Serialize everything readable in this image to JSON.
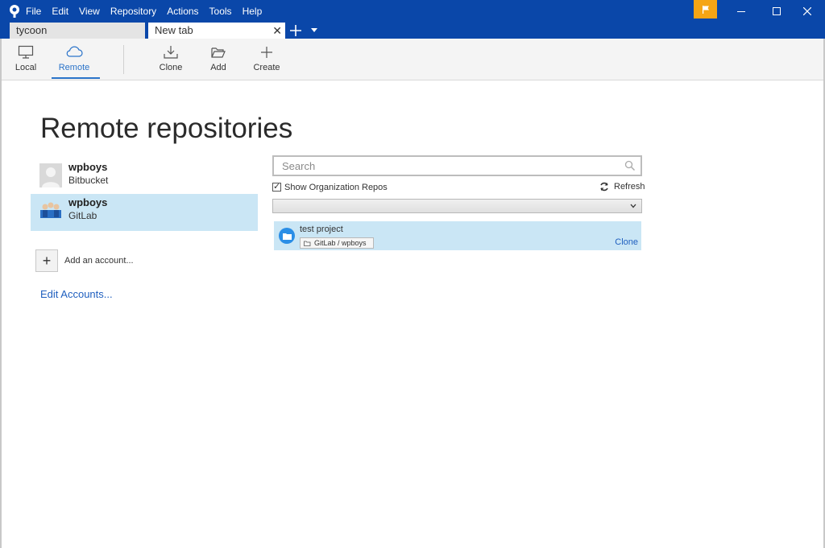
{
  "menu": [
    "File",
    "Edit",
    "View",
    "Repository",
    "Actions",
    "Tools",
    "Help"
  ],
  "tabs": [
    {
      "label": "tycoon"
    },
    {
      "label": "New tab",
      "close": "✕"
    }
  ],
  "toolbar": {
    "local": "Local",
    "remote": "Remote",
    "clone": "Clone",
    "add": "Add",
    "create": "Create"
  },
  "page": {
    "title": "Remote repositories"
  },
  "accounts": [
    {
      "name": "wpboys",
      "host": "Bitbucket"
    },
    {
      "name": "wpboys",
      "host": "GitLab",
      "selected": true
    }
  ],
  "add_account": {
    "icon": "+",
    "label": "Add an account..."
  },
  "edit_accounts": "Edit Accounts...",
  "search": {
    "placeholder": "Search",
    "value": ""
  },
  "org_repos": {
    "label": "Show Organization Repos",
    "checked": true,
    "check_mark": "✓"
  },
  "refresh": "Refresh",
  "dropdown": {
    "selected": ""
  },
  "repos": [
    {
      "name": "test project",
      "path": "GitLab / wpboys",
      "action": "Clone"
    }
  ],
  "colors": {
    "titlebar": "#0a47a9",
    "accent": "#2a73c9",
    "selection": "#cae6f5",
    "flag": "#f5a515",
    "link": "#1f5fbf"
  },
  "icons": [
    "app-logo-icon",
    "flag-icon",
    "minimize-icon",
    "maximize-icon",
    "close-icon",
    "monitor-icon",
    "cloud-icon",
    "download-icon",
    "folder-open-icon",
    "plus-icon",
    "search-icon",
    "refresh-icon",
    "chevron-down-icon",
    "folder-icon"
  ]
}
